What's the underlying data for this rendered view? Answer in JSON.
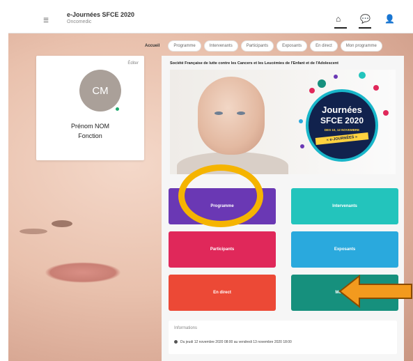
{
  "header": {
    "title": "e-Journées SFCE 2020",
    "subtitle": "Oncomedic",
    "menu_icon": "menu-icon",
    "icons": [
      "home-icon",
      "chat-icon",
      "user-icon"
    ]
  },
  "tabs": [
    "Accueil",
    "Programme",
    "Intervenants",
    "Participants",
    "Exposants",
    "En direct",
    "Mon programme"
  ],
  "profile": {
    "edit_label": "Éditer",
    "initials": "CM",
    "name": "Prénom NOM",
    "role": "Fonction",
    "status_color": "#1faa6e"
  },
  "main": {
    "org_title": "Société Française de lutte contre les Cancers et les Leucémies de l'Enfant et de l'Adolescent",
    "event": {
      "title_line1": "Journées",
      "title_line2": "SFCE 2020",
      "dates": "DES 10, 12 NOVEMBRE",
      "badge": "« e-JOURNÉES »"
    },
    "tiles": [
      {
        "label": "Programme",
        "color": "#6a38b4"
      },
      {
        "label": "Intervenants",
        "color": "#23c4bc"
      },
      {
        "label": "Participants",
        "color": "#e0285a"
      },
      {
        "label": "Exposants",
        "color": "#2aa9dd"
      },
      {
        "label": "En direct",
        "color": "#ec4936"
      },
      {
        "label": "Mon prog",
        "color": "#16907d"
      }
    ],
    "info": {
      "title": "Informations",
      "line": "Du jeudi 12 novembre 2020 08:00 au vendredi 13 novembre 2020 18:00"
    }
  },
  "annotations": {
    "highlight_color": "#f5b400",
    "arrow_color": "#f39a1e"
  }
}
